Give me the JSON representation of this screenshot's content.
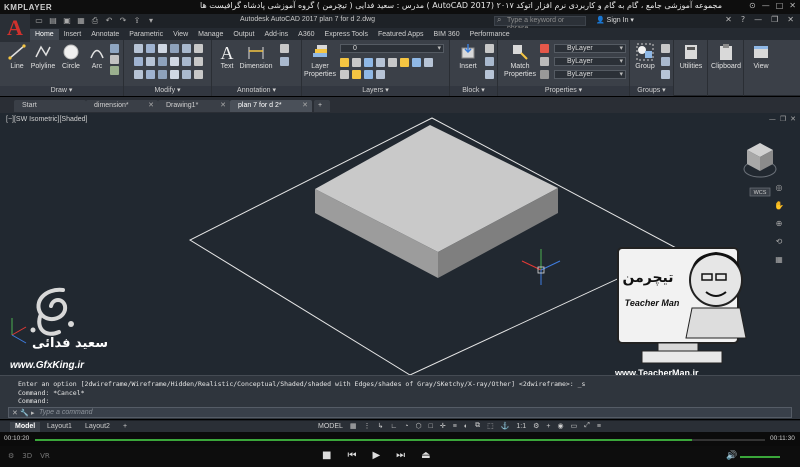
{
  "kmplayer": {
    "logo": "KMPLAYER",
    "caption": "مجموعه آموزشی جامع ، گام به گام و کاربردی نرم افزار  اتوکد ۲۰۱۷ (AutoCAD 2017 )  مدرس : سعید فدایی ( تیچرمن ) گروه آموزشی پادشاه گرافیست ها",
    "time_current": "00:10:20",
    "time_total": "00:11:30",
    "progress": 0.9
  },
  "acad": {
    "title": "Autodesk AutoCAD 2017    plan 7 for d 2.dwg",
    "search_placeholder": "Type a keyword or phrase",
    "signin": "Sign In"
  },
  "ribbon_tabs": [
    "Home",
    "Insert",
    "Annotate",
    "Parametric",
    "View",
    "Manage",
    "Output",
    "Add-ins",
    "A360",
    "Express Tools",
    "Featured Apps",
    "BIM 360",
    "Performance"
  ],
  "ribbon": {
    "draw": {
      "label": "Draw ▾",
      "line": "Line",
      "polyline": "Polyline",
      "circle": "Circle",
      "arc": "Arc"
    },
    "modify": {
      "label": "Modify ▾"
    },
    "annotation": {
      "label": "Annotation ▾",
      "text": "Text",
      "dimension": "Dimension"
    },
    "layers": {
      "label": "Layers ▾",
      "layer_properties": "Layer Properties",
      "layer_value": "0"
    },
    "block": {
      "label": "Block ▾",
      "insert": "Insert"
    },
    "properties": {
      "label": "Properties ▾",
      "match": "Match Properties",
      "bylayer1": "ByLayer",
      "bylayer2": "ByLayer",
      "bylayer3": "ByLayer"
    },
    "groups": {
      "label": "Groups ▾",
      "group": "Group"
    },
    "utilities": "Utilities",
    "clipboard": "Clipboard",
    "view": "View"
  },
  "file_tabs": [
    {
      "label": "Start"
    },
    {
      "label": "dimension*"
    },
    {
      "label": "Drawing1*"
    },
    {
      "label": "plan 7 for d 2*"
    }
  ],
  "viewport": {
    "label": "[−][SW Isometric][Shaded]",
    "viewcube_label": "WCS"
  },
  "watermark": {
    "name": "سعید فدائی",
    "site_left": "www.GfxKing.ir",
    "site_right": "www.TeacherMan.ir",
    "teacher_fa": "تیچرمن",
    "teacher_en": "Teacher Man"
  },
  "command": {
    "line1": "Enter an option [2dwireframe/Wireframe/Hidden/Realistic/Conceptual/Shaded/shaded with Edges/shades of Gray/SKetchy/X-ray/Other] <2dwireframe>: _s",
    "line2": "Command: *Cancel*",
    "line3": "Command:",
    "placeholder": "Type a command"
  },
  "layout_tabs": [
    "Model",
    "Layout1",
    "Layout2"
  ],
  "status": {
    "model": "MODEL",
    "scale": "1:1"
  },
  "colors": {
    "canvas": "#212830",
    "ribbon": "#3b4048",
    "accent_green": "#3aa63a",
    "acad_red": "#d0312d"
  }
}
